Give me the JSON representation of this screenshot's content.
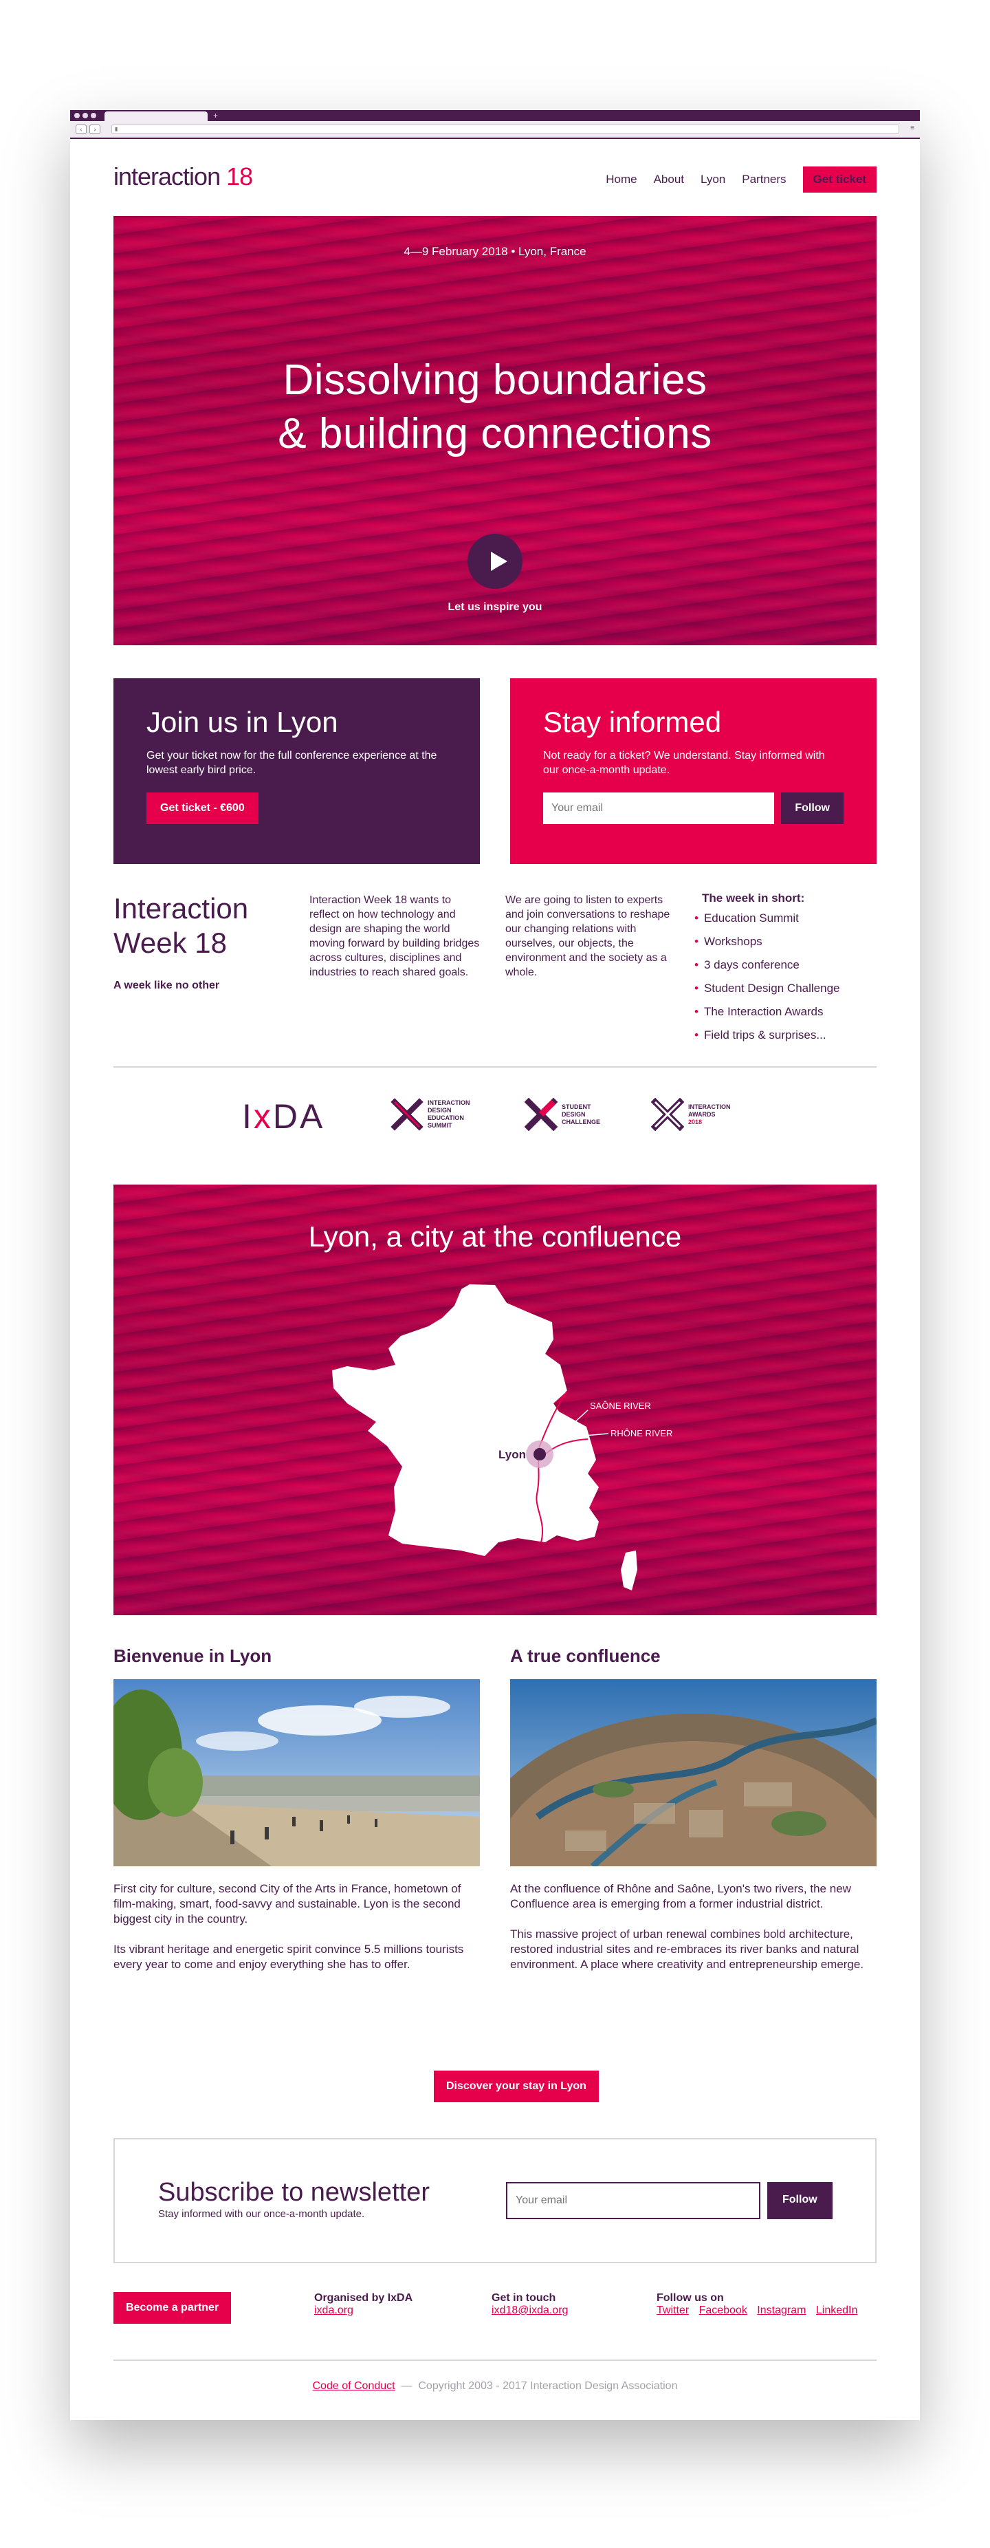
{
  "nav": {
    "logo_main": "interaction",
    "logo_year": "18",
    "items": [
      {
        "label": "Home"
      },
      {
        "label": "About"
      },
      {
        "label": "Lyon"
      },
      {
        "label": "Partners"
      }
    ],
    "cta": "Get ticket"
  },
  "hero": {
    "date": "4—9 February 2018 • Lyon, France",
    "title_line1": "Dissolving boundaries",
    "title_line2": "& building connections",
    "cta": "Let us inspire you"
  },
  "join": {
    "title": "Join us in Lyon",
    "text": "Get your ticket now for the full conference experience at the lowest early bird price.",
    "button": "Get ticket - €600"
  },
  "informed": {
    "title": "Stay informed",
    "text": "Not ready for a ticket? We understand. Stay informed with our once-a-month update.",
    "placeholder": "Your email",
    "button": "Follow"
  },
  "week": {
    "title_line1": "Interaction",
    "title_line2": "Week 18",
    "tagline": "A week like no other",
    "col1": "Interaction Week 18 wants to reflect on how technology and design are shaping the world moving forward by building bridges across cultures, disciplines and industries to reach shared goals.",
    "col2": "We are going to listen to experts and join conversations to reshape our changing relations with ourselves, our objects, the environment and the society as a whole.",
    "list_title": "The week in short:",
    "list": [
      "Education Summit",
      "Workshops",
      "3 days conference",
      "Student Design Challenge",
      "The Interaction Awards",
      "Field trips & surprises..."
    ]
  },
  "logos": {
    "ixda": "IxDA",
    "items": [
      {
        "lines": [
          "INTERACTION",
          "DESIGN",
          "EDUCATION",
          "SUMMIT"
        ]
      },
      {
        "lines": [
          "STUDENT",
          "DESIGN",
          "CHALLENGE"
        ]
      },
      {
        "lines": [
          "INTERACTION",
          "AWARDS",
          "2018"
        ]
      }
    ]
  },
  "map": {
    "title": "Lyon, a city at the confluence",
    "city": "Lyon",
    "river1": "SAÔNE RIVER",
    "river2": "RHÔNE RIVER"
  },
  "bienvenue": {
    "title": "Bienvenue in Lyon",
    "p1": "First city for culture, second City of the Arts in France, hometown of film-making, smart, food-savvy and sustainable. Lyon is the second biggest city in the country.",
    "p2": "Its vibrant heritage and energetic spirit convince 5.5 millions tourists every year to come and enjoy everything she has to offer."
  },
  "confluence": {
    "title": "A true confluence",
    "p1": "At the confluence of Rhône and Saône, Lyon's two rivers, the new Confluence area is emerging from a former industrial district.",
    "p2": "This massive project of urban renewal combines bold architecture, restored industrial sites and re-embraces its river banks and natural environment. A place where creativity and entrepreneurship emerge."
  },
  "discover": "Discover your stay in Lyon",
  "newsletter": {
    "title": "Subscribe to newsletter",
    "sub": "Stay informed with our once-a-month update.",
    "placeholder": "Your email",
    "button": "Follow"
  },
  "footer": {
    "partner": "Become a partner",
    "org_head": "Organised by IxDA",
    "org_link": "ixda.org",
    "contact_head": "Get in touch",
    "contact_link": "ixd18@ixda.org",
    "follow_head": "Follow us on",
    "social": [
      "Twitter",
      "Facebook",
      "Instagram",
      "LinkedIn"
    ]
  },
  "copyright": {
    "link": "Code of Conduct",
    "dash": "—",
    "text": "Copyright 2003 - 2017 Interaction Design Association"
  },
  "colors": {
    "purple": "#4a1c4e",
    "pink": "#e6004c"
  }
}
